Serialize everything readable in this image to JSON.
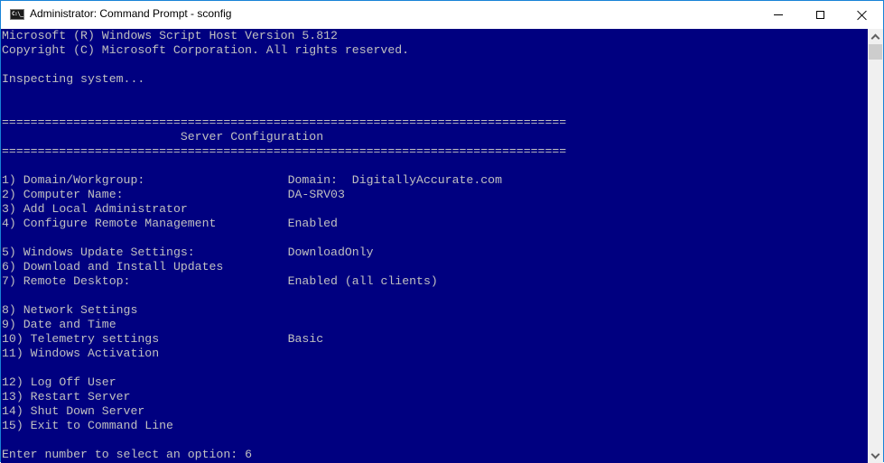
{
  "window": {
    "title": "Administrator: Command Prompt - sconfig",
    "icon": "command-prompt-icon",
    "icon_text": "C:\\_",
    "controls": {
      "minimize": "minimize-icon",
      "maximize": "maximize-icon",
      "close": "close-icon"
    }
  },
  "colors": {
    "console_background": "#000080",
    "console_text": "#c0c0c0",
    "window_border": "#1883d7"
  },
  "console": {
    "header": [
      "Microsoft (R) Windows Script Host Version 5.812",
      "Copyright (C) Microsoft Corporation. All rights reserved.",
      "",
      "Inspecting system...",
      "",
      ""
    ],
    "separator": "===============================================================================",
    "section_title": "                         Server Configuration",
    "menu": [
      {
        "num": "1)",
        "label": "Domain/Workgroup:",
        "value": "Domain:  DigitallyAccurate.com"
      },
      {
        "num": "2)",
        "label": "Computer Name:",
        "value": "DA-SRV03"
      },
      {
        "num": "3)",
        "label": "Add Local Administrator",
        "value": ""
      },
      {
        "num": "4)",
        "label": "Configure Remote Management",
        "value": "Enabled"
      },
      null,
      {
        "num": "5)",
        "label": "Windows Update Settings:",
        "value": "DownloadOnly"
      },
      {
        "num": "6)",
        "label": "Download and Install Updates",
        "value": ""
      },
      {
        "num": "7)",
        "label": "Remote Desktop:",
        "value": "Enabled (all clients)"
      },
      null,
      {
        "num": "8)",
        "label": "Network Settings",
        "value": ""
      },
      {
        "num": "9)",
        "label": "Date and Time",
        "value": ""
      },
      {
        "num": "10)",
        "label": "Telemetry settings",
        "value": "Basic"
      },
      {
        "num": "11)",
        "label": "Windows Activation",
        "value": ""
      },
      null,
      {
        "num": "12)",
        "label": "Log Off User",
        "value": ""
      },
      {
        "num": "13)",
        "label": "Restart Server",
        "value": ""
      },
      {
        "num": "14)",
        "label": "Shut Down Server",
        "value": ""
      },
      {
        "num": "15)",
        "label": "Exit to Command Line",
        "value": ""
      }
    ],
    "prompt": "Enter number to select an option: ",
    "input_value": "6"
  },
  "scrollbar": {
    "up": "chevron-up-icon",
    "down": "chevron-down-icon"
  }
}
